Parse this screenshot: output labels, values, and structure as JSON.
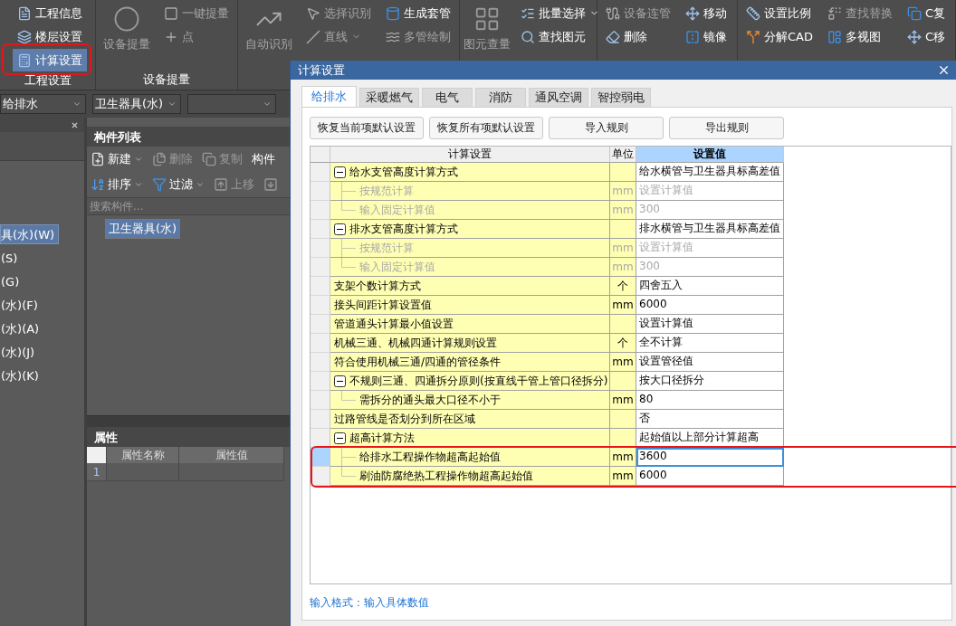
{
  "ribbon": {
    "groups": [
      {
        "label": "工程设置",
        "columns": [
          {
            "kind": "small",
            "items": [
              {
                "label": "工程信息",
                "disabled": false,
                "dropdown": false,
                "selected": false,
                "marked": false
              },
              {
                "label": "楼层设置",
                "disabled": false,
                "dropdown": false,
                "selected": false,
                "marked": false
              },
              {
                "label": "计算设置",
                "disabled": false,
                "dropdown": false,
                "selected": true,
                "marked": true
              }
            ]
          }
        ]
      },
      {
        "label": "设备提量",
        "columns": [
          {
            "kind": "large",
            "items": [
              {
                "label": "设备提量",
                "disabled": true,
                "dropdown": false,
                "selected": false,
                "marked": false
              }
            ]
          },
          {
            "kind": "small",
            "items": [
              {
                "label": "一键提量",
                "disabled": true,
                "dropdown": false,
                "selected": false,
                "marked": false
              },
              {
                "label": "点",
                "disabled": true,
                "dropdown": false,
                "selected": false,
                "marked": false
              }
            ]
          }
        ]
      },
      {
        "columns": [
          {
            "kind": "large",
            "items": [
              {
                "label": "自动识别",
                "disabled": true,
                "dropdown": false,
                "selected": false,
                "marked": false
              }
            ]
          },
          {
            "kind": "small",
            "items": [
              {
                "label": "选择识别",
                "disabled": true,
                "dropdown": false,
                "selected": false,
                "marked": false
              },
              {
                "label": "直线",
                "disabled": true,
                "dropdown": true,
                "selected": false,
                "marked": false
              }
            ]
          },
          {
            "kind": "small",
            "items": [
              {
                "label": "生成套管",
                "disabled": false,
                "dropdown": false,
                "selected": false,
                "marked": false
              },
              {
                "label": "多管绘制",
                "disabled": true,
                "dropdown": false,
                "selected": false,
                "marked": false
              }
            ]
          }
        ]
      },
      {
        "columns": [
          {
            "kind": "large",
            "items": [
              {
                "label": "图元查量",
                "disabled": true,
                "dropdown": false,
                "selected": false,
                "marked": false
              }
            ]
          },
          {
            "kind": "small",
            "items": [
              {
                "label": "批量选择",
                "disabled": false,
                "dropdown": true,
                "selected": false,
                "marked": false
              },
              {
                "label": "查找图元",
                "disabled": false,
                "dropdown": false,
                "selected": false,
                "marked": false
              }
            ]
          }
        ]
      },
      {
        "columns": [
          {
            "kind": "small",
            "items": [
              {
                "label": "设备连管",
                "disabled": true,
                "dropdown": false,
                "selected": false,
                "marked": false
              },
              {
                "label": "删除",
                "disabled": false,
                "dropdown": false,
                "selected": false,
                "marked": false
              }
            ]
          },
          {
            "kind": "small",
            "items": [
              {
                "label": "移动",
                "disabled": false,
                "dropdown": false,
                "selected": false,
                "marked": false
              },
              {
                "label": "镜像",
                "disabled": false,
                "dropdown": false,
                "selected": false,
                "marked": false
              }
            ]
          }
        ]
      },
      {
        "columns": [
          {
            "kind": "small",
            "items": [
              {
                "label": "设置比例",
                "disabled": false,
                "dropdown": false,
                "selected": false,
                "marked": false
              },
              {
                "label": "分解CAD",
                "disabled": false,
                "dropdown": false,
                "selected": false,
                "marked": false
              }
            ]
          },
          {
            "kind": "small",
            "items": [
              {
                "label": "查找替换",
                "disabled": true,
                "dropdown": false,
                "selected": false,
                "marked": false
              },
              {
                "label": "多视图",
                "disabled": false,
                "dropdown": false,
                "selected": false,
                "marked": false
              }
            ]
          },
          {
            "kind": "small",
            "items": [
              {
                "label": "C复",
                "disabled": false,
                "dropdown": false,
                "selected": false,
                "marked": false
              },
              {
                "label": "C移",
                "disabled": false,
                "dropdown": false,
                "selected": false,
                "marked": false
              }
            ]
          }
        ]
      }
    ]
  },
  "combos": [
    {
      "kind": "combo",
      "value": "给排水"
    },
    {
      "kind": "combo",
      "value": "卫生器具(水)"
    },
    {
      "kind": "combo"
    }
  ],
  "nav_items": [
    {
      "label": "具(水)(W)",
      "selected": true
    },
    {
      "label": "(S)",
      "selected": false
    },
    {
      "label": "(G)",
      "selected": false
    },
    {
      "label": "(水)(F)",
      "selected": false
    },
    {
      "label": "(水)(A)",
      "selected": false
    },
    {
      "label": "(水)(J)",
      "selected": false
    },
    {
      "label": "(水)(K)",
      "selected": false
    }
  ],
  "component_list": {
    "title": "构件列表",
    "toolbar": [
      [
        {
          "kind": "icon-text",
          "label": "新建",
          "disabled": false,
          "dropdown": true
        },
        {
          "kind": "icon-text",
          "label": "删除",
          "disabled": true,
          "dropdown": false
        },
        {
          "kind": "icon-text",
          "label": "复制",
          "disabled": true,
          "dropdown": false
        },
        {
          "kind": "text",
          "label": "构件",
          "disabled": false,
          "dropdown": false
        }
      ],
      [
        {
          "kind": "icon-text",
          "label": "排序",
          "disabled": false,
          "dropdown": true
        },
        {
          "kind": "icon-text",
          "label": "过滤",
          "disabled": false,
          "dropdown": true
        },
        {
          "kind": "icon-text",
          "label": "上移",
          "disabled": true,
          "dropdown": false
        },
        {
          "kind": "icon",
          "disabled": true,
          "dropdown": false
        }
      ]
    ],
    "search": {
      "placeholder": "搜索构件..."
    },
    "items": [
      {
        "label": "卫生器具(水)",
        "selected": true
      }
    ]
  },
  "properties": {
    "title": "属性",
    "columns": [
      "属性名称",
      "属性值"
    ],
    "rows": [
      {
        "index": "1"
      }
    ]
  },
  "dialog": {
    "title": "计算设置",
    "tabs": [
      {
        "label": "给排水",
        "selected": true
      },
      {
        "label": "采暖燃气",
        "selected": false
      },
      {
        "label": "电气",
        "selected": false
      },
      {
        "label": "消防",
        "selected": false
      },
      {
        "label": "通风空调",
        "selected": false
      },
      {
        "label": "智控弱电",
        "selected": false
      }
    ],
    "buttons": [
      "恢复当前项默认设置",
      "恢复所有项默认设置",
      "导入规则",
      "导出规则"
    ],
    "grid": {
      "columns": [
        {
          "label": "计算设置",
          "selected": false
        },
        {
          "label": "单位",
          "selected": false
        },
        {
          "label": "设置值",
          "selected": true
        }
      ],
      "rows": [
        {
          "name": "给水支管高度计算方式",
          "value": "给水横管与卫生器具标高差值",
          "disabled": false,
          "selected": false,
          "marked": false,
          "expanded": true,
          "children": [
            {
              "name": "按规范计算",
              "unit": "mm",
              "value": "设置计算值",
              "disabled": true,
              "selected": false,
              "marked": false
            },
            {
              "name": "输入固定计算值",
              "unit": "mm",
              "value": "300",
              "disabled": true,
              "selected": false,
              "marked": false
            }
          ]
        },
        {
          "name": "排水支管高度计算方式",
          "value": "排水横管与卫生器具标高差值",
          "disabled": false,
          "selected": false,
          "marked": false,
          "expanded": true,
          "children": [
            {
              "name": "按规范计算",
              "unit": "mm",
              "value": "设置计算值",
              "disabled": true,
              "selected": false,
              "marked": false
            },
            {
              "name": "输入固定计算值",
              "unit": "mm",
              "value": "300",
              "disabled": true,
              "selected": false,
              "marked": false
            }
          ]
        },
        {
          "name": "支架个数计算方式",
          "unit": "个",
          "value": "四舍五入",
          "disabled": false,
          "selected": false,
          "marked": false
        },
        {
          "name": "接头间距计算设置值",
          "unit": "mm",
          "value": "6000",
          "disabled": false,
          "selected": false,
          "marked": false
        },
        {
          "name": "管道通头计算最小值设置",
          "value": "设置计算值",
          "disabled": false,
          "selected": false,
          "marked": false
        },
        {
          "name": "机械三通、机械四通计算规则设置",
          "unit": "个",
          "value": "全不计算",
          "disabled": false,
          "selected": false,
          "marked": false
        },
        {
          "name": "符合使用机械三通/四通的管径条件",
          "unit": "mm",
          "value": "设置管径值",
          "disabled": false,
          "selected": false,
          "marked": false
        },
        {
          "name": "不规则三通、四通拆分原则(按直线干管上管口径拆分)",
          "value": "按大口径拆分",
          "disabled": false,
          "selected": false,
          "marked": false,
          "expanded": true,
          "children": [
            {
              "name": "需拆分的通头最大口径不小于",
              "unit": "mm",
              "value": "80",
              "disabled": false,
              "selected": false,
              "marked": false
            }
          ]
        },
        {
          "name": "过路管线是否划分到所在区域",
          "value": "否",
          "disabled": false,
          "selected": false,
          "marked": false
        },
        {
          "name": "超高计算方法",
          "value": "起始值以上部分计算超高",
          "disabled": false,
          "selected": false,
          "marked": false,
          "expanded": true,
          "children": [
            {
              "name": "给排水工程操作物超高起始值",
              "unit": "mm",
              "value": "3600",
              "disabled": false,
              "selected": true,
              "marked": true
            },
            {
              "name": "刷油防腐绝热工程操作物超高起始值",
              "unit": "mm",
              "value": "6000",
              "disabled": false,
              "selected": false,
              "marked": true
            }
          ]
        }
      ]
    },
    "hint": "输入格式：输入具体数值"
  }
}
